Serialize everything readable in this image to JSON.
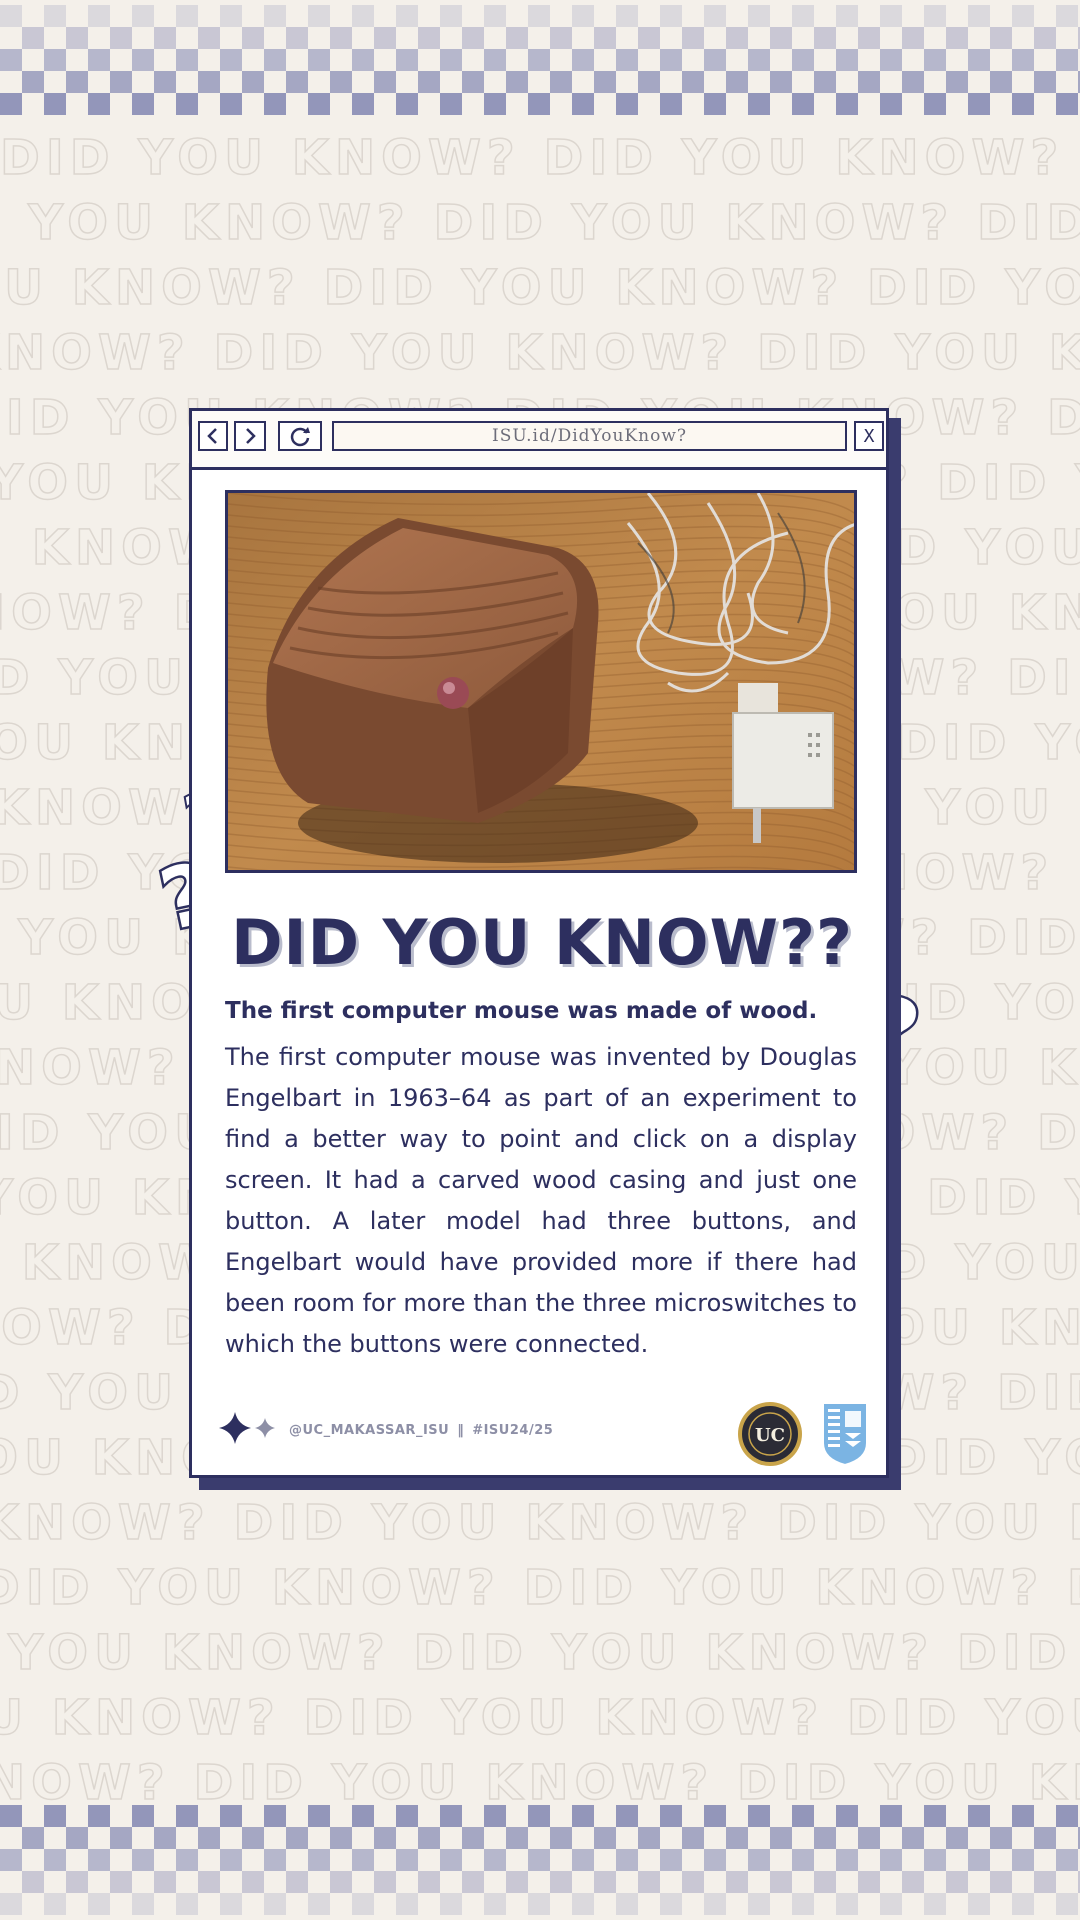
{
  "background": {
    "watermark_text": "DID YOU KNOW? DID YOU KNOW? DID YOU KNOW? DID YOU KNOW?"
  },
  "browser": {
    "url": "ISU.id/DidYouKnow?",
    "close_label": "X",
    "back_icon": "chevron-left-icon",
    "forward_icon": "chevron-right-icon",
    "reload_icon": "reload-icon"
  },
  "content": {
    "headline": "DID YOU KNOW??",
    "subheading": "The first computer mouse was made of wood.",
    "body": "The first computer mouse was invented by Douglas Engelbart in 1963–64 as part of an experiment to find a better way to point and click on a display screen. It had a carved wood casing and just one button. A later model had three buttons, and Engelbart would have provided more if there had been room for more than the three microswitches to which the buttons were connected."
  },
  "footer": {
    "handle": "@UC_MAKASSAR_ISU",
    "separator": "‖",
    "hashtag": "#ISU24/25",
    "logo_uc_text": "UC"
  },
  "colors": {
    "navy": "#2d2f5f",
    "background": "#f4f0ea",
    "checker": "#8f93b8"
  }
}
